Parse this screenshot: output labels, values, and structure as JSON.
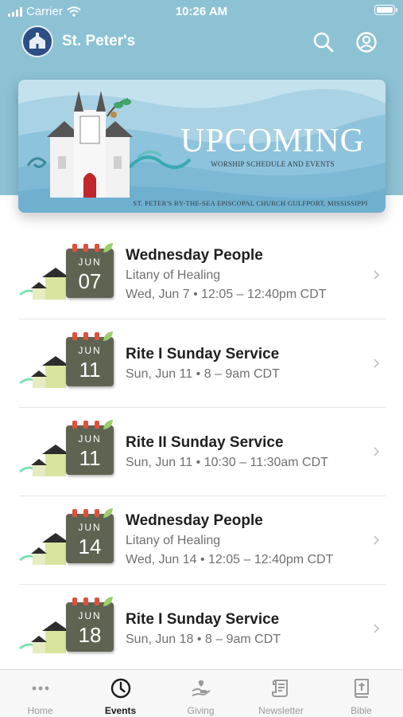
{
  "status_bar": {
    "carrier": "Carrier",
    "time": "10:26 AM"
  },
  "header": {
    "title": "St. Peter's"
  },
  "banner": {
    "title": "UPCOMING",
    "subtitle": "WORSHIP SCHEDULE AND EVENTS",
    "footer": "ST. PETER'S BY-THE-SEA EPISCOPAL CHURCH GULFPORT, MISSISSIPPI"
  },
  "events": [
    {
      "title": "Wednesday People",
      "subtitle": "Litany of Healing",
      "datetime": "Wed, Jun 7 • 12:05 – 12:40pm CDT",
      "month": "JUN",
      "day": "07"
    },
    {
      "title": "Rite I Sunday Service",
      "subtitle": "",
      "datetime": "Sun, Jun 11 • 8 – 9am CDT",
      "month": "JUN",
      "day": "11"
    },
    {
      "title": "Rite II Sunday Service",
      "subtitle": "",
      "datetime": "Sun, Jun 11 • 10:30 – 11:30am CDT",
      "month": "JUN",
      "day": "11"
    },
    {
      "title": "Wednesday People",
      "subtitle": "Litany of Healing",
      "datetime": "Wed, Jun 14 • 12:05 – 12:40pm CDT",
      "month": "JUN",
      "day": "14"
    },
    {
      "title": "Rite I Sunday Service",
      "subtitle": "",
      "datetime": "Sun, Jun 18 • 8 – 9am CDT",
      "month": "JUN",
      "day": "18"
    }
  ],
  "tabs": [
    {
      "label": "Home",
      "icon": "more-dots-icon"
    },
    {
      "label": "Events",
      "icon": "clock-icon"
    },
    {
      "label": "Giving",
      "icon": "giving-hand-icon"
    },
    {
      "label": "Newsletter",
      "icon": "newsletter-scroll-icon"
    },
    {
      "label": "Bible",
      "icon": "bible-icon"
    }
  ],
  "active_tab": "Events",
  "colors": {
    "header_bg": "#8cc2d4",
    "calendar_red": "#e0513d",
    "calendar_body": "#5f6452"
  }
}
